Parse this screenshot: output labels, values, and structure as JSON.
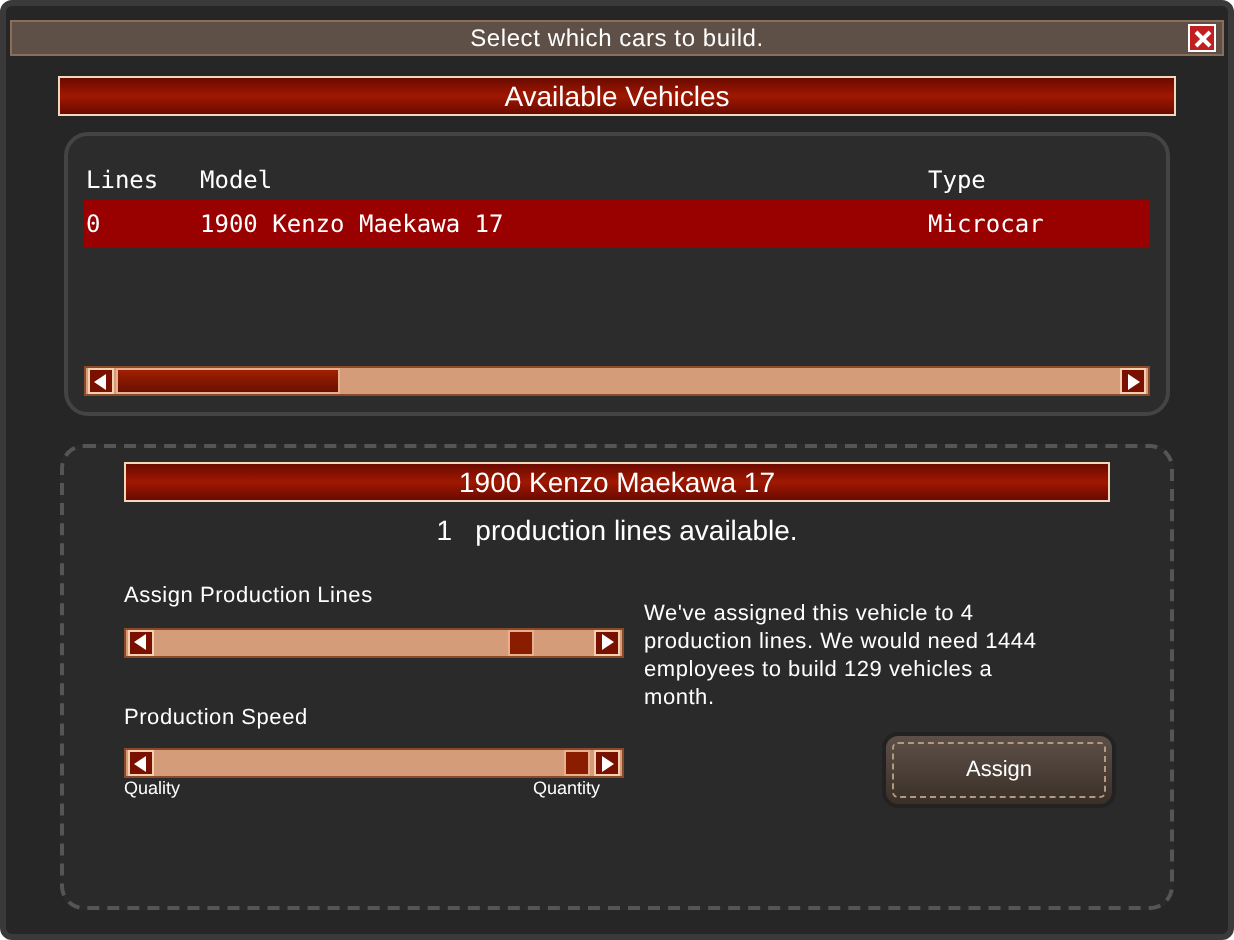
{
  "window": {
    "title": "Select which cars to build."
  },
  "available": {
    "title": "Available Vehicles",
    "columns": [
      "Lines",
      "Model",
      "Type"
    ],
    "rows": [
      {
        "cells": [
          "0",
          "1900 Kenzo Maekawa 17",
          "Microcar"
        ],
        "selected": true
      }
    ]
  },
  "details": {
    "title": "1900 Kenzo Maekawa 17",
    "availability": "1   production lines available.",
    "sliders": [
      {
        "label": "Assign Production Lines",
        "level": 0.86
      },
      {
        "label": "Production Speed",
        "level": 1,
        "min_label": "Quality",
        "max_label": "Quantity"
      }
    ],
    "description": "We've assigned this vehicle to 4 production lines. We would need 1444 employees to build 129 vehicles a month.",
    "button": "Assign"
  }
}
